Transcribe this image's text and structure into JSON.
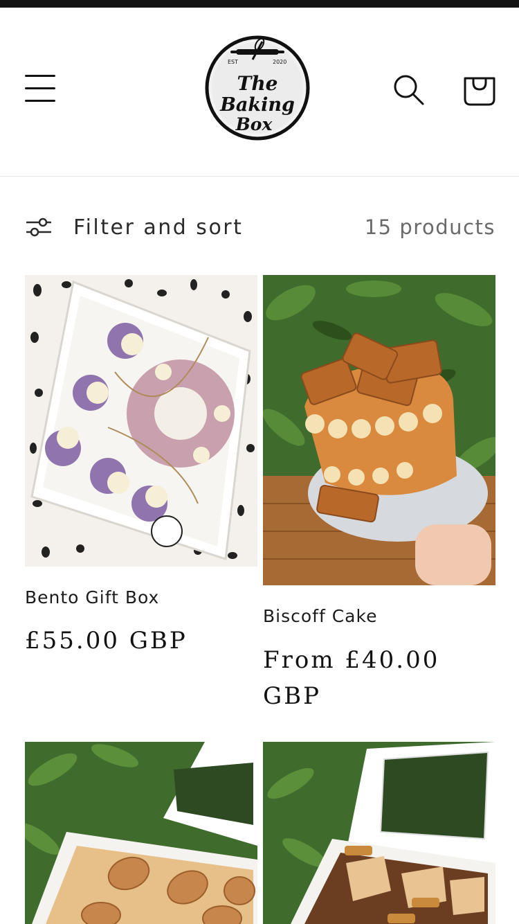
{
  "header": {
    "menu_icon": "hamburger-menu-icon",
    "logo": {
      "est_left": "EST",
      "est_right": "2020",
      "line1": "The",
      "line2": "Baking",
      "line3": "Box"
    },
    "search_icon": "search-icon",
    "cart_icon": "cart-icon"
  },
  "filter": {
    "icon": "filter-sliders-icon",
    "label": "Filter and sort",
    "count": "15 products"
  },
  "products": [
    {
      "title": "Bento Gift Box",
      "price": "£55.00 GBP",
      "colors": {
        "bg": "#f4f1ec",
        "accent": "#9c7fb0"
      }
    },
    {
      "title": "Biscoff Cake",
      "price": "From £40.00 GBP",
      "colors": {
        "bg": "#3f6b2c",
        "accent": "#d98a3e"
      }
    },
    {
      "title": "",
      "price": "",
      "colors": {
        "bg": "#3f6b2c",
        "accent": "#c7874c"
      }
    },
    {
      "title": "",
      "price": "",
      "colors": {
        "bg": "#3f6b2c",
        "accent": "#8a5a3a"
      }
    }
  ]
}
